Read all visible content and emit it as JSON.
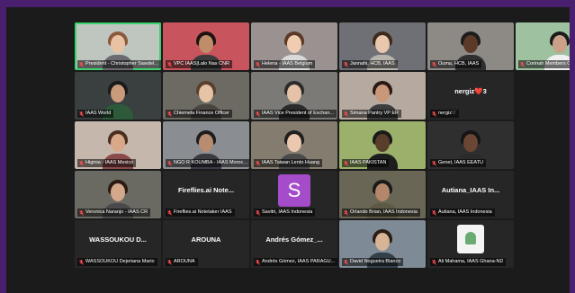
{
  "participants": [
    {
      "name": "President - Christopher Sawdel B...",
      "display": "",
      "talking": true,
      "bg": "#bfc6c0",
      "skin": "#e9c2a4",
      "hair": "#8a5a3a",
      "shirt": "#6a6a70",
      "icon": "mic-muted-icon"
    },
    {
      "name": "VPC IAAS|Lalo Nas CNR",
      "display": "",
      "talking": false,
      "bg": "#c8555e",
      "skin": "#c08d6a",
      "hair": "#1d1410",
      "shirt": "#3a3a3a",
      "icon": "mic-muted-icon"
    },
    {
      "name": "Helena - IAAS Belgium",
      "display": "",
      "talking": false,
      "bg": "#9a9290",
      "skin": "#f0cdb2",
      "hair": "#5a3a26",
      "shirt": "#d9d9d9",
      "icon": "mic-muted-icon"
    },
    {
      "name": "Jannahi, HCB, IAAS",
      "display": "",
      "talking": false,
      "bg": "#6f7076",
      "skin": "#e9c6ae",
      "hair": "#3e2a1d",
      "shirt": "#b8b4ac",
      "icon": "mic-muted-icon"
    },
    {
      "name": "Ouma, HCB, IAAS",
      "display": "",
      "talking": false,
      "bg": "#8d8a86",
      "skin": "#5b3a27",
      "hair": "#1c1c1c",
      "shirt": "#2f2f2f",
      "icon": "mic-muted-icon"
    },
    {
      "name": "Corinah Members Officer",
      "display": "",
      "talking": false,
      "bg": "#9ec1a0",
      "skin": "#caa088",
      "hair": "#1b1b1b",
      "shirt": "#f0f0f0",
      "icon": "mic-muted-icon"
    },
    {
      "name": "IAAS World",
      "display": "",
      "talking": false,
      "bg": "#3a3f3f",
      "skin": "#c99b7a",
      "hair": "#1a1a1a",
      "shirt": "#2d5a3a",
      "icon": "mic-muted-icon"
    },
    {
      "name": "Chiemela Finance Officer",
      "display": "",
      "talking": false,
      "bg": "#6d6a64",
      "skin": "#e6c2a6",
      "hair": "#5a402c",
      "shirt": "#4a4540",
      "icon": "mic-muted-icon"
    },
    {
      "name": "IAAS Vice President of Exchan...",
      "display": "",
      "talking": false,
      "bg": "#7b7a76",
      "skin": "#e6c3a8",
      "hair": "#2b2b2b",
      "shirt": "#2c2c2c",
      "icon": "mic-muted-icon"
    },
    {
      "name": "Simana Pantry VP ER",
      "display": "",
      "talking": false,
      "bg": "#b6aaa0",
      "skin": "#c9987a",
      "hair": "#2a1a12",
      "shirt": "#3d3d3d",
      "icon": "mic-muted-icon"
    },
    {
      "name": "nergiz♡",
      "display": "nergiz❤️3",
      "talking": false,
      "bg": "#262626",
      "icon": "mic-muted-icon"
    },
    {
      "name": "",
      "display": "",
      "talking": false,
      "bg": "#1b1b1b",
      "empty": true
    },
    {
      "name": "Higinia - IAAS Mexico",
      "display": "",
      "talking": false,
      "bg": "#c6b7ac",
      "skin": "#d8a888",
      "hair": "#4a2e20",
      "shirt": "#8a4a4a",
      "icon": "mic-muted-icon"
    },
    {
      "name": "NGO R KOUMBA - IAAS Morocco",
      "display": "",
      "talking": false,
      "bg": "#8a8e92",
      "skin": "#b88c70",
      "hair": "#1d1d1d",
      "shirt": "#3a3a44",
      "icon": "mic-muted-icon"
    },
    {
      "name": "IAAS Taiwan Lento Huang",
      "display": "",
      "talking": false,
      "bg": "#857c70",
      "skin": "#eac7ae",
      "hair": "#1f1f1f",
      "shirt": "#4a4a4a",
      "icon": "mic-muted-icon"
    },
    {
      "name": "IAAS PAKISTAN",
      "display": "",
      "talking": false,
      "bg": "#9bb06a",
      "skin": "#5a3e2c",
      "hair": "#1a1a1a",
      "shirt": "#1e1e1e",
      "icon": "mic-muted-icon"
    },
    {
      "name": "Genet, IAAS EEATU",
      "display": "",
      "talking": false,
      "bg": "#2f2f2f",
      "skin": "#6b4634",
      "hair": "#151515",
      "shirt": "#2b2b2b",
      "icon": "mic-muted-icon"
    },
    {
      "name": "",
      "display": "",
      "talking": false,
      "bg": "#1b1b1b",
      "empty": true
    },
    {
      "name": "Veronica Naranjo - IAAS CR",
      "display": "",
      "talking": false,
      "bg": "#6a6a62",
      "skin": "#d4a88a",
      "hair": "#2b1b12",
      "shirt": "#4a4a4a",
      "icon": "mic-muted-icon"
    },
    {
      "name": "Fireflies.ai Notetaker IAAS",
      "display": "Fireflies.ai  Note...",
      "talking": false,
      "bg": "#262626",
      "icon": "mic-muted-icon"
    },
    {
      "name": "Savitri, IAAS Indonesia",
      "display": "",
      "talking": false,
      "bg": "#262626",
      "letter": "S",
      "letter_color": "#a44cc9",
      "icon": "mic-muted-icon"
    },
    {
      "name": "Orlando Brian, IAAS Indonesia",
      "display": "",
      "talking": false,
      "bg": "#6a6656",
      "skin": "#b5876a",
      "hair": "#1a1a1a",
      "shirt": "#5c5a44",
      "icon": "mic-muted-icon"
    },
    {
      "name": "Autiana, IAAS Indonesia",
      "display": "Autiana_IAAS In...",
      "talking": false,
      "bg": "#262626",
      "icon": "mic-muted-icon"
    },
    {
      "name": "",
      "display": "",
      "talking": false,
      "bg": "#1b1b1b",
      "empty": true
    },
    {
      "name": "WASSOUKOU Dejeriana Mario",
      "display": "WASSOUKOU  D...",
      "talking": false,
      "bg": "#262626",
      "icon": "mic-muted-icon"
    },
    {
      "name": "AROUNA",
      "display": "AROUNA",
      "talking": false,
      "bg": "#262626",
      "icon": "mic-muted-icon"
    },
    {
      "name": "Andrés Gómez, IAAS PARAGU...",
      "display": "Andrés  Gómez_...",
      "talking": false,
      "bg": "#262626",
      "icon": "mic-muted-icon"
    },
    {
      "name": "David Nogueira Blanco",
      "display": "",
      "talking": false,
      "bg": "#7e8a96",
      "skin": "#d8b496",
      "hair": "#2a1d14",
      "shirt": "#33404a",
      "icon": "mic-muted-icon"
    },
    {
      "name": "Ali Mahama, IAAS Ghana-ND",
      "display": "",
      "talking": false,
      "bg": "#262626",
      "logo": true,
      "icon": "mic-muted-icon"
    }
  ]
}
